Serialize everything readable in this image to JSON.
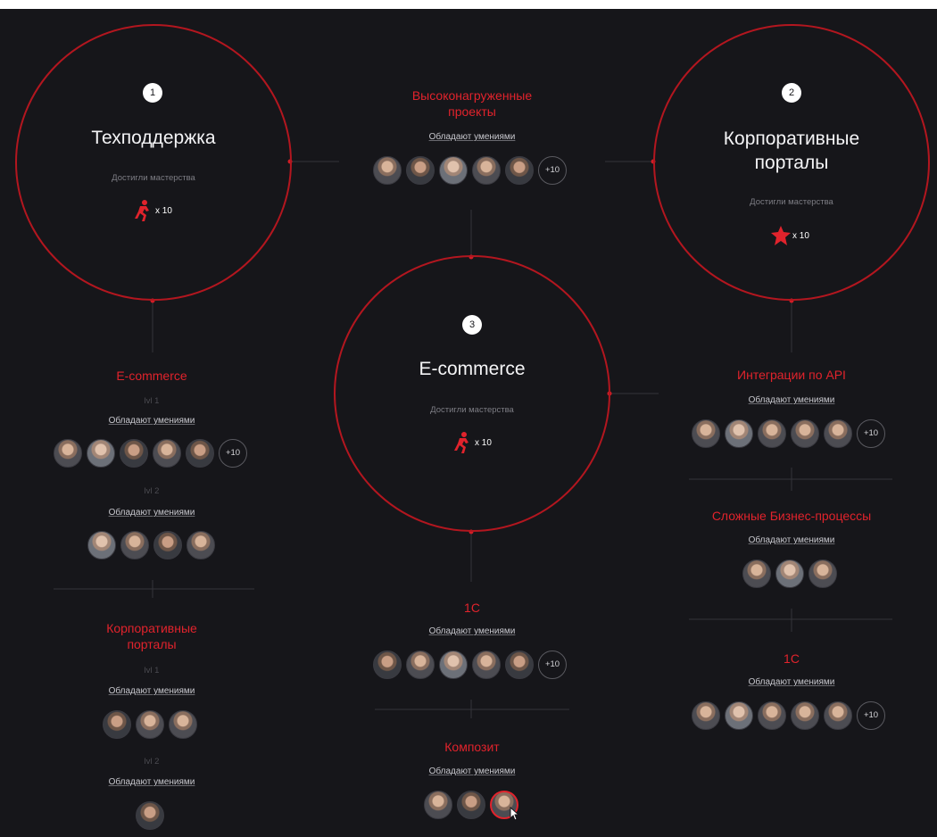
{
  "circles": [
    {
      "num": "1",
      "title": "Техподдержка",
      "subtitle": "Достигли мастерства",
      "badge_count": "x 10",
      "badge_icon": "runner-icon"
    },
    {
      "num": "2",
      "title_lines": [
        "Корпоративные",
        "порталы"
      ],
      "subtitle": "Достигли мастерства",
      "badge_count": "x 10",
      "badge_icon": "star-figure-icon"
    },
    {
      "num": "3",
      "title": "E-commerce",
      "subtitle": "Достигли мастерства",
      "badge_count": "x 10",
      "badge_icon": "runner-icon"
    }
  ],
  "skills_label": "Обладают умениями",
  "center": {
    "top": {
      "title_lines": [
        "Высоконагруженные",
        "проекты"
      ],
      "more": "+10"
    },
    "onec": {
      "title": "1С",
      "more": "+10"
    },
    "kompozit": {
      "title": "Композит"
    }
  },
  "left": {
    "ecommerce": {
      "title": "E-commerce",
      "lvl1": "lvl 1",
      "lvl2": "lvl 2",
      "more": "+10"
    },
    "portals": {
      "title_lines": [
        "Корпоративные",
        "порталы"
      ],
      "lvl1": "lvl 1",
      "lvl2": "lvl 2"
    }
  },
  "right": {
    "api": {
      "title": "Интеграции по API",
      "more": "+10"
    },
    "business": {
      "title": "Сложные Бизнес-процессы"
    },
    "onec": {
      "title": "1С",
      "more": "+10"
    }
  },
  "colors": {
    "accent": "#e1232c",
    "circle": "#b3161f",
    "background": "#16161a"
  }
}
